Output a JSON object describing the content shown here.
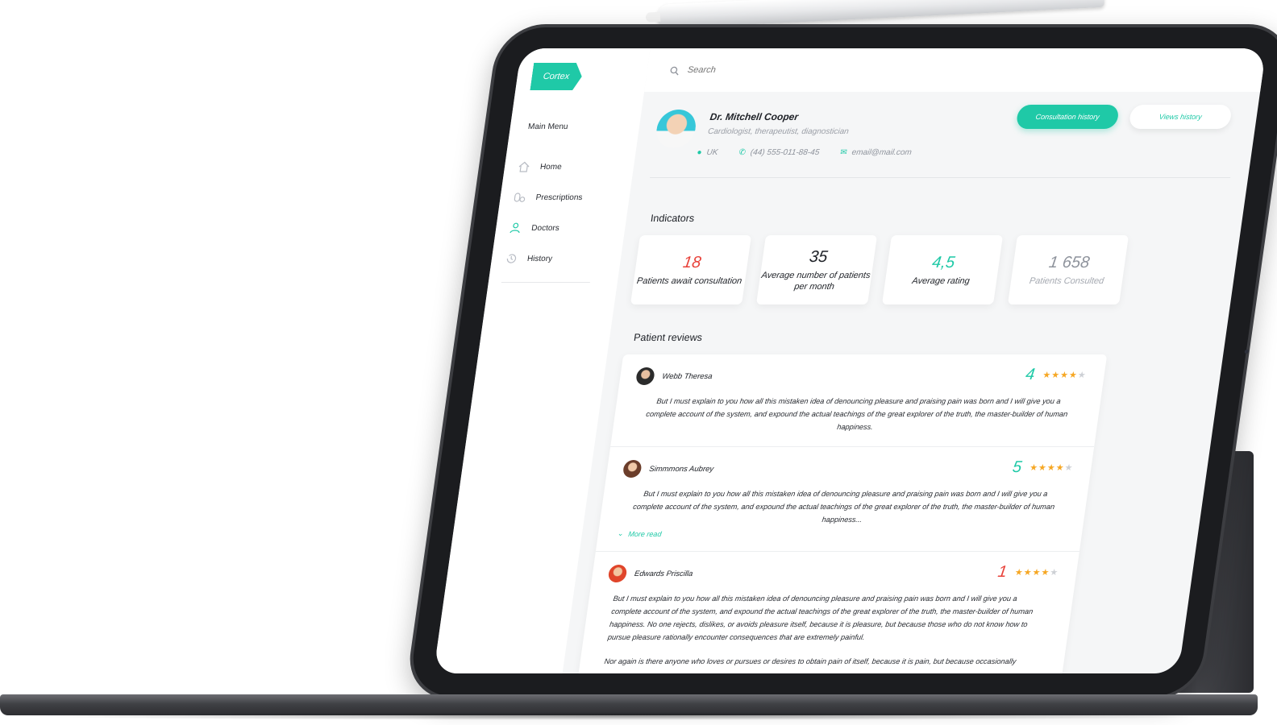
{
  "app": {
    "logo": "Cortex",
    "menu_title": "Main Menu",
    "menu": [
      {
        "label": "Home",
        "icon": "home-icon"
      },
      {
        "label": "Prescriptions",
        "icon": "pills-icon"
      },
      {
        "label": "Doctors",
        "icon": "doctor-icon",
        "active": true
      },
      {
        "label": "History",
        "icon": "history-icon"
      }
    ],
    "search": {
      "placeholder": "Search",
      "icon": "search-icon"
    },
    "doctor": {
      "name": "Dr. Mitchell Cooper",
      "specialty": "Cardiologist, therapeutist, diagnostician",
      "country": "UK",
      "phone": "(44) 555-011-88-45",
      "email": "email@mail.com"
    },
    "buttons": {
      "consultation_history": "Consultation history",
      "views_history": "Views history"
    },
    "indicators_title": "Indicators",
    "indicators": [
      {
        "value": "18",
        "label": "Patients await consultation",
        "color": "#e8423a"
      },
      {
        "value": "35",
        "label": "Average number of patients per month",
        "color": "#1d2026"
      },
      {
        "value": "4,5",
        "label": "Average rating",
        "color": "#1fc9a7"
      },
      {
        "value": "1 658",
        "label": "Patients Consulted",
        "color": "#8e939c"
      }
    ],
    "reviews_title": "Patient reviews",
    "reviews": [
      {
        "name": "Webb Theresa",
        "score": "4",
        "score_color": "#1fc9a7",
        "stars": 4,
        "text": "But I must explain to you how all this mistaken idea of denouncing pleasure and praising pain was born and I will give you a complete account of the system, and expound the actual teachings of the great explorer of the truth, the master-builder of human happiness."
      },
      {
        "name": "Simmmons Aubrey",
        "score": "5",
        "score_color": "#1fc9a7",
        "stars": 4,
        "text": "But I must explain to you how all this mistaken idea of denouncing pleasure and praising pain was born and I will give you a complete account of the system, and expound the actual teachings of the great explorer of the truth, the master-builder of human happiness...",
        "more": "More read"
      },
      {
        "name": "Edwards Priscilla",
        "score": "1",
        "score_color": "#e8423a",
        "stars": 4,
        "text": "But I must explain to you how all this mistaken idea of denouncing pleasure and praising pain was born and I will give you a complete account of the system, and expound the actual teachings of the great explorer of the truth, the master-builder of human happiness. No one rejects, dislikes, or avoids pleasure itself, because it is pleasure, but because those who do not know how to pursue pleasure rationally encounter consequences that are extremely painful.",
        "text2": "Nor again is there anyone who loves or pursues or desires to obtain pain of itself, because it is pain, but because occasionally"
      }
    ],
    "accent": "#1fc9a7"
  }
}
